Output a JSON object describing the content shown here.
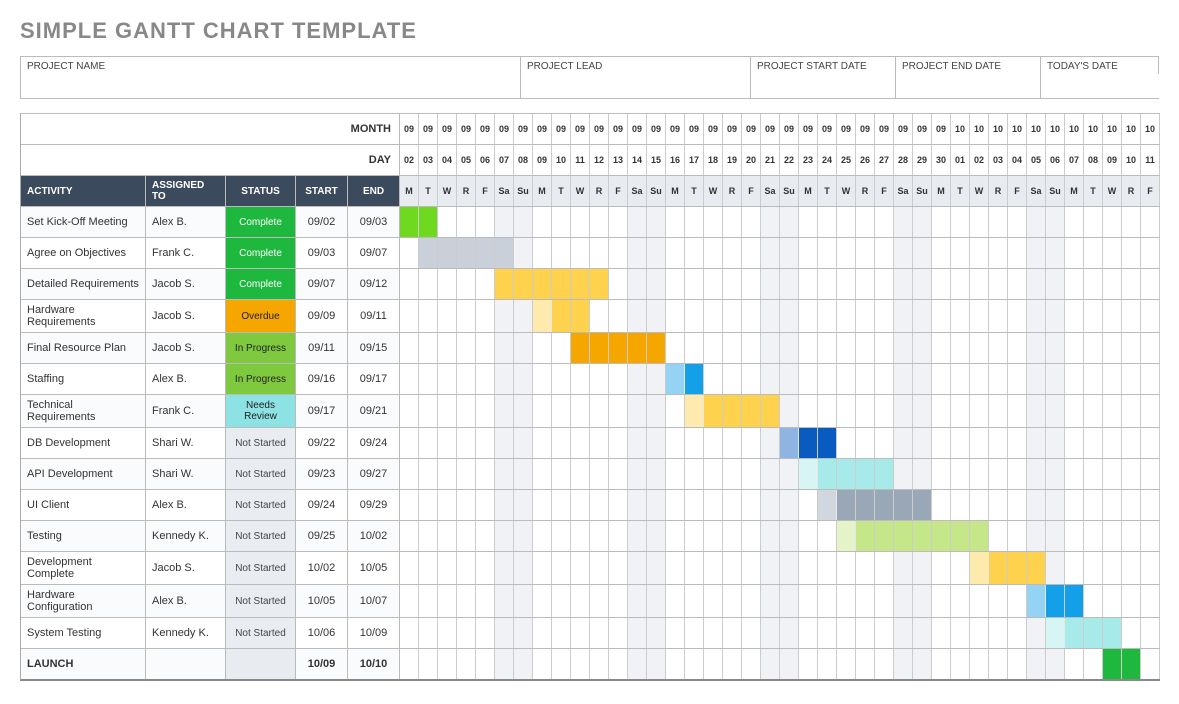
{
  "title": "SIMPLE GANTT CHART TEMPLATE",
  "meta_labels": {
    "project_name": "PROJECT NAME",
    "project_lead": "PROJECT LEAD",
    "start_date": "PROJECT START DATE",
    "end_date": "PROJECT END DATE",
    "today": "TODAY'S DATE"
  },
  "meta_values": {
    "project_name": "",
    "project_lead": "",
    "start_date": "",
    "end_date": "",
    "today": ""
  },
  "header_row_labels": {
    "month": "MONTH",
    "day": "DAY"
  },
  "columns": {
    "activity": "ACTIVITY",
    "assigned": "ASSIGNED TO",
    "status": "STATUS",
    "start": "START",
    "end": "END"
  },
  "timeline": {
    "start": "09/02",
    "days": [
      {
        "m": "09",
        "d": "02",
        "w": "M"
      },
      {
        "m": "09",
        "d": "03",
        "w": "T"
      },
      {
        "m": "09",
        "d": "04",
        "w": "W"
      },
      {
        "m": "09",
        "d": "05",
        "w": "R"
      },
      {
        "m": "09",
        "d": "06",
        "w": "F"
      },
      {
        "m": "09",
        "d": "07",
        "w": "Sa"
      },
      {
        "m": "09",
        "d": "08",
        "w": "Su"
      },
      {
        "m": "09",
        "d": "09",
        "w": "M"
      },
      {
        "m": "09",
        "d": "10",
        "w": "T"
      },
      {
        "m": "09",
        "d": "11",
        "w": "W"
      },
      {
        "m": "09",
        "d": "12",
        "w": "R"
      },
      {
        "m": "09",
        "d": "13",
        "w": "F"
      },
      {
        "m": "09",
        "d": "14",
        "w": "Sa"
      },
      {
        "m": "09",
        "d": "15",
        "w": "Su"
      },
      {
        "m": "09",
        "d": "16",
        "w": "M"
      },
      {
        "m": "09",
        "d": "17",
        "w": "T"
      },
      {
        "m": "09",
        "d": "18",
        "w": "W"
      },
      {
        "m": "09",
        "d": "19",
        "w": "R"
      },
      {
        "m": "09",
        "d": "20",
        "w": "F"
      },
      {
        "m": "09",
        "d": "21",
        "w": "Sa"
      },
      {
        "m": "09",
        "d": "22",
        "w": "Su"
      },
      {
        "m": "09",
        "d": "23",
        "w": "M"
      },
      {
        "m": "09",
        "d": "24",
        "w": "T"
      },
      {
        "m": "09",
        "d": "25",
        "w": "W"
      },
      {
        "m": "09",
        "d": "26",
        "w": "R"
      },
      {
        "m": "09",
        "d": "27",
        "w": "F"
      },
      {
        "m": "09",
        "d": "28",
        "w": "Sa"
      },
      {
        "m": "09",
        "d": "29",
        "w": "Su"
      },
      {
        "m": "09",
        "d": "30",
        "w": "M"
      },
      {
        "m": "10",
        "d": "01",
        "w": "T"
      },
      {
        "m": "10",
        "d": "02",
        "w": "W"
      },
      {
        "m": "10",
        "d": "03",
        "w": "R"
      },
      {
        "m": "10",
        "d": "04",
        "w": "F"
      },
      {
        "m": "10",
        "d": "05",
        "w": "Sa"
      },
      {
        "m": "10",
        "d": "06",
        "w": "Su"
      },
      {
        "m": "10",
        "d": "07",
        "w": "M"
      },
      {
        "m": "10",
        "d": "08",
        "w": "T"
      },
      {
        "m": "10",
        "d": "09",
        "w": "W"
      },
      {
        "m": "10",
        "d": "10",
        "w": "R"
      },
      {
        "m": "10",
        "d": "11",
        "w": "F"
      }
    ]
  },
  "status_styles": {
    "Complete": "status-complete",
    "Overdue": "status-overdue",
    "In Progress": "status-inprogress",
    "Needs Review": "status-needsreview",
    "Not Started": "status-notstarted",
    "": "status-none"
  },
  "tasks": [
    {
      "activity": "Set Kick-Off Meeting",
      "assigned": "Alex B.",
      "status": "Complete",
      "start": "09/02",
      "end": "09/03",
      "bar_start": 0,
      "bar_len": 2,
      "color": "#6ed91f",
      "fade_first": false
    },
    {
      "activity": "Agree on Objectives",
      "assigned": "Frank C.",
      "status": "Complete",
      "start": "09/03",
      "end": "09/07",
      "bar_start": 1,
      "bar_len": 5,
      "color": "#c9d0da",
      "fade_first": false
    },
    {
      "activity": "Detailed Requirements",
      "assigned": "Jacob S.",
      "status": "Complete",
      "start": "09/07",
      "end": "09/12",
      "bar_start": 5,
      "bar_len": 6,
      "color": "#ffd24d",
      "fade_first": false
    },
    {
      "activity": "Hardware Requirements",
      "assigned": "Jacob S.",
      "status": "Overdue",
      "start": "09/09",
      "end": "09/11",
      "bar_start": 7,
      "bar_len": 3,
      "color": "#ffd24d",
      "fade_first": true
    },
    {
      "activity": "Final Resource Plan",
      "assigned": "Jacob S.",
      "status": "In Progress",
      "start": "09/11",
      "end": "09/15",
      "bar_start": 9,
      "bar_len": 5,
      "color": "#f5a700",
      "fade_first": false
    },
    {
      "activity": "Staffing",
      "assigned": "Alex B.",
      "status": "In Progress",
      "start": "09/16",
      "end": "09/17",
      "bar_start": 14,
      "bar_len": 2,
      "color": "#14a0e8",
      "fade_first": true
    },
    {
      "activity": "Technical Requirements",
      "assigned": "Frank C.",
      "status": "Needs Review",
      "start": "09/17",
      "end": "09/21",
      "bar_start": 15,
      "bar_len": 5,
      "color": "#ffd24d",
      "fade_first": true
    },
    {
      "activity": "DB Development",
      "assigned": "Shari W.",
      "status": "Not Started",
      "start": "09/22",
      "end": "09/24",
      "bar_start": 20,
      "bar_len": 3,
      "color": "#0a5bbf",
      "fade_first": true
    },
    {
      "activity": "API Development",
      "assigned": "Shari W.",
      "status": "Not Started",
      "start": "09/23",
      "end": "09/27",
      "bar_start": 21,
      "bar_len": 5,
      "color": "#a7eaea",
      "fade_first": true
    },
    {
      "activity": "UI Client",
      "assigned": "Alex B.",
      "status": "Not Started",
      "start": "09/24",
      "end": "09/29",
      "bar_start": 22,
      "bar_len": 6,
      "color": "#9aa7b7",
      "fade_first": true
    },
    {
      "activity": "Testing",
      "assigned": "Kennedy K.",
      "status": "Not Started",
      "start": "09/25",
      "end": "10/02",
      "bar_start": 23,
      "bar_len": 8,
      "color": "#c6e68a",
      "fade_first": true
    },
    {
      "activity": "Development Complete",
      "assigned": "Jacob S.",
      "status": "Not Started",
      "start": "10/02",
      "end": "10/05",
      "bar_start": 30,
      "bar_len": 4,
      "color": "#ffd24d",
      "fade_first": true
    },
    {
      "activity": "Hardware Configuration",
      "assigned": "Alex B.",
      "status": "Not Started",
      "start": "10/05",
      "end": "10/07",
      "bar_start": 33,
      "bar_len": 3,
      "color": "#14a0e8",
      "fade_first": true
    },
    {
      "activity": "System Testing",
      "assigned": "Kennedy K.",
      "status": "Not Started",
      "start": "10/06",
      "end": "10/09",
      "bar_start": 34,
      "bar_len": 4,
      "color": "#a7eaea",
      "fade_first": true
    },
    {
      "activity": "LAUNCH",
      "assigned": "",
      "status": "",
      "start": "10/09",
      "end": "10/10",
      "bar_start": 37,
      "bar_len": 2,
      "color": "#1fb83f",
      "fade_first": false,
      "launch": true
    }
  ],
  "chart_data": {
    "type": "gantt",
    "title": "SIMPLE GANTT CHART TEMPLATE",
    "x_axis": "calendar days 09/02 – 10/11",
    "weekday_codes": [
      "M",
      "T",
      "W",
      "R",
      "F",
      "Sa",
      "Su"
    ],
    "series": [
      {
        "name": "Set Kick-Off Meeting",
        "assigned": "Alex B.",
        "status": "Complete",
        "start": "09/02",
        "end": "09/03",
        "color": "green"
      },
      {
        "name": "Agree on Objectives",
        "assigned": "Frank C.",
        "status": "Complete",
        "start": "09/03",
        "end": "09/07",
        "color": "grey"
      },
      {
        "name": "Detailed Requirements",
        "assigned": "Jacob S.",
        "status": "Complete",
        "start": "09/07",
        "end": "09/12",
        "color": "yellow"
      },
      {
        "name": "Hardware Requirements",
        "assigned": "Jacob S.",
        "status": "Overdue",
        "start": "09/09",
        "end": "09/11",
        "color": "yellow"
      },
      {
        "name": "Final Resource Plan",
        "assigned": "Jacob S.",
        "status": "In Progress",
        "start": "09/11",
        "end": "09/15",
        "color": "orange"
      },
      {
        "name": "Staffing",
        "assigned": "Alex B.",
        "status": "In Progress",
        "start": "09/16",
        "end": "09/17",
        "color": "blue"
      },
      {
        "name": "Technical Requirements",
        "assigned": "Frank C.",
        "status": "Needs Review",
        "start": "09/17",
        "end": "09/21",
        "color": "yellow"
      },
      {
        "name": "DB Development",
        "assigned": "Shari W.",
        "status": "Not Started",
        "start": "09/22",
        "end": "09/24",
        "color": "dark-blue"
      },
      {
        "name": "API Development",
        "assigned": "Shari W.",
        "status": "Not Started",
        "start": "09/23",
        "end": "09/27",
        "color": "cyan"
      },
      {
        "name": "UI Client",
        "assigned": "Alex B.",
        "status": "Not Started",
        "start": "09/24",
        "end": "09/29",
        "color": "grey"
      },
      {
        "name": "Testing",
        "assigned": "Kennedy K.",
        "status": "Not Started",
        "start": "09/25",
        "end": "10/02",
        "color": "light-green"
      },
      {
        "name": "Development Complete",
        "assigned": "Jacob S.",
        "status": "Not Started",
        "start": "10/02",
        "end": "10/05",
        "color": "yellow"
      },
      {
        "name": "Hardware Configuration",
        "assigned": "Alex B.",
        "status": "Not Started",
        "start": "10/05",
        "end": "10/07",
        "color": "blue"
      },
      {
        "name": "System Testing",
        "assigned": "Kennedy K.",
        "status": "Not Started",
        "start": "10/06",
        "end": "10/09",
        "color": "cyan"
      },
      {
        "name": "LAUNCH",
        "assigned": "",
        "status": "",
        "start": "10/09",
        "end": "10/10",
        "color": "green"
      }
    ]
  }
}
